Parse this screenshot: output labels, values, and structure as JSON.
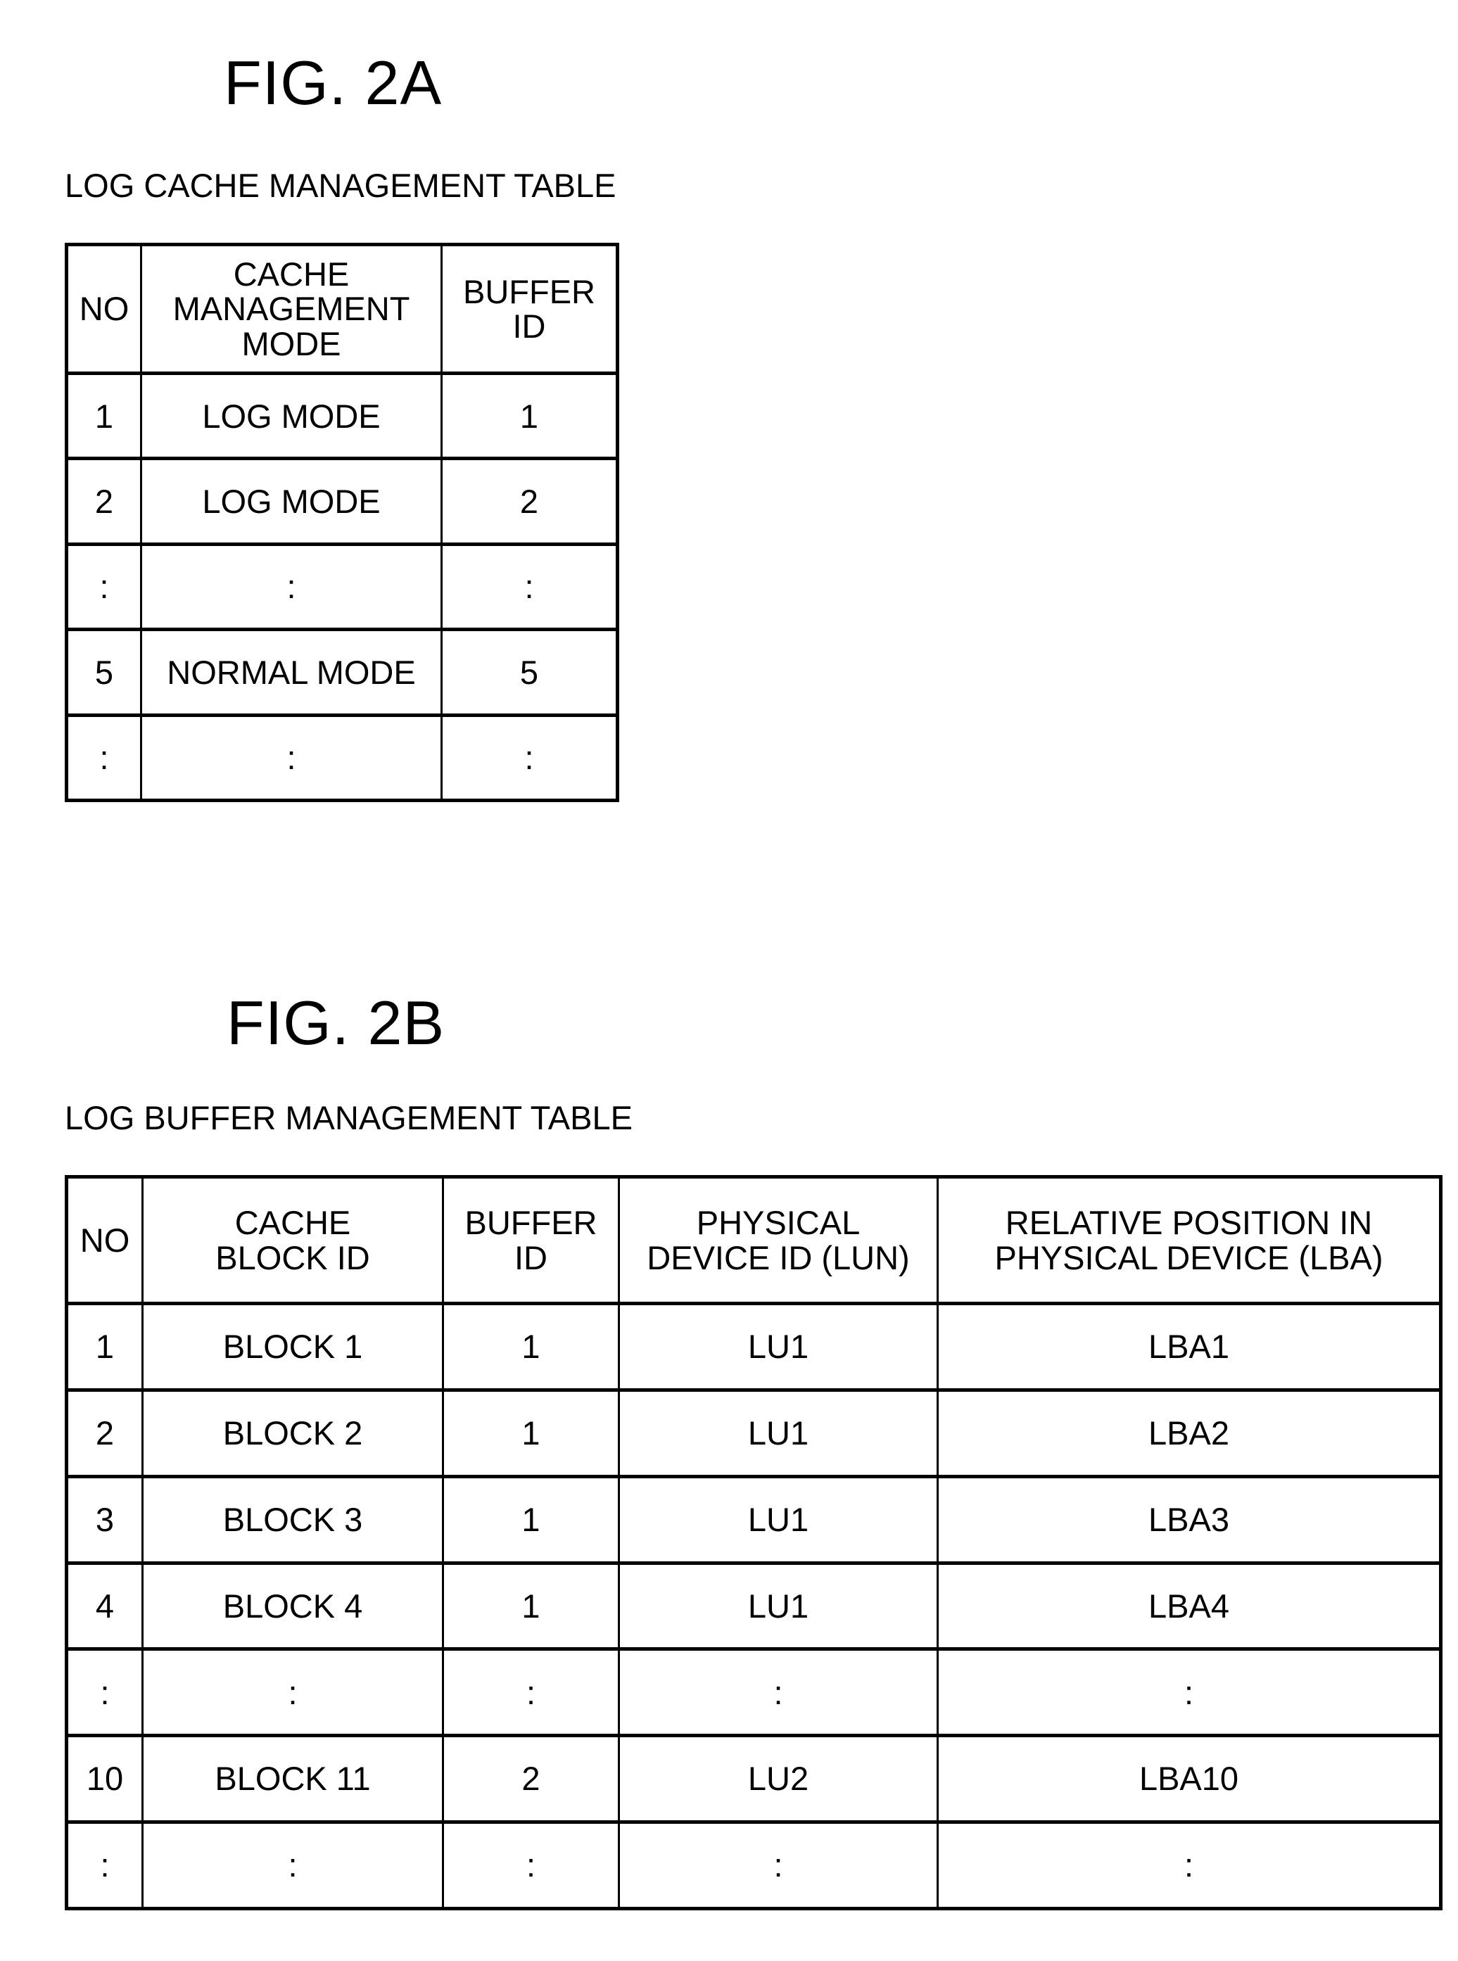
{
  "fig_2a": {
    "title": "FIG. 2A",
    "caption": "LOG CACHE MANAGEMENT TABLE",
    "headers": [
      [
        "NO"
      ],
      [
        "CACHE",
        "MANAGEMENT",
        "MODE"
      ],
      [
        "BUFFER",
        "ID"
      ]
    ],
    "rows": [
      [
        "1",
        "LOG MODE",
        "1"
      ],
      [
        "2",
        "LOG MODE",
        "2"
      ],
      [
        ":",
        ":",
        ":"
      ],
      [
        "5",
        "NORMAL MODE",
        "5"
      ],
      [
        ":",
        ":",
        ":"
      ]
    ]
  },
  "fig_2b": {
    "title": "FIG. 2B",
    "caption": "LOG BUFFER MANAGEMENT TABLE",
    "headers": [
      [
        "NO"
      ],
      [
        "CACHE",
        "BLOCK ID"
      ],
      [
        "BUFFER",
        "ID"
      ],
      [
        "PHYSICAL",
        "DEVICE ID (LUN)"
      ],
      [
        "RELATIVE POSITION IN",
        "PHYSICAL DEVICE (LBA)"
      ]
    ],
    "rows": [
      [
        "1",
        "BLOCK 1",
        "1",
        "LU1",
        "LBA1"
      ],
      [
        "2",
        "BLOCK 2",
        "1",
        "LU1",
        "LBA2"
      ],
      [
        "3",
        "BLOCK 3",
        "1",
        "LU1",
        "LBA3"
      ],
      [
        "4",
        "BLOCK 4",
        "1",
        "LU1",
        "LBA4"
      ],
      [
        ":",
        ":",
        ":",
        ":",
        ":"
      ],
      [
        "10",
        "BLOCK 11",
        "2",
        "LU2",
        "LBA10"
      ],
      [
        ":",
        ":",
        ":",
        ":",
        ":"
      ]
    ]
  }
}
